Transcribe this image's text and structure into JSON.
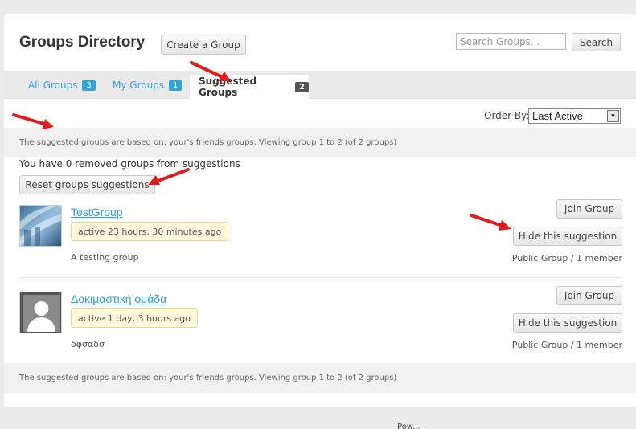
{
  "header": {
    "title": "Groups Directory",
    "create_label": "Create a Group",
    "search_placeholder": "Search Groups...",
    "search_label": "Search"
  },
  "tabs": [
    {
      "label": "All Groups",
      "count": "3"
    },
    {
      "label": "My Groups",
      "count": "1"
    },
    {
      "label": "Suggested Groups",
      "count": "2"
    }
  ],
  "order_by": {
    "label": "Order By:",
    "selected": "Last Active"
  },
  "info_text": "The suggested groups are based on: your's friends groups. Viewing group 1 to 2 (of 2 groups)",
  "removed_text": "You have 0 removed groups from suggestions",
  "reset_label": "Reset groups suggestions",
  "groups": [
    {
      "name": "TestGroup",
      "activity": "active 23 hours, 30 minutes ago",
      "description": "A testing group",
      "meta": "Public Group / 1 member",
      "join_label": "Join Group",
      "hide_label": "Hide this suggestion"
    },
    {
      "name": "Δοκιμαστική ομάδα",
      "activity": "active 1 day, 3 hours ago",
      "description": "δφσαδσ",
      "meta": "Public Group / 1 member",
      "join_label": "Join Group",
      "hide_label": "Hide this suggestion"
    }
  ],
  "colors": {
    "accent": "#2aa0d4",
    "annotation_arrow": "#e21b1b"
  },
  "footer_fragment": "Pow..."
}
